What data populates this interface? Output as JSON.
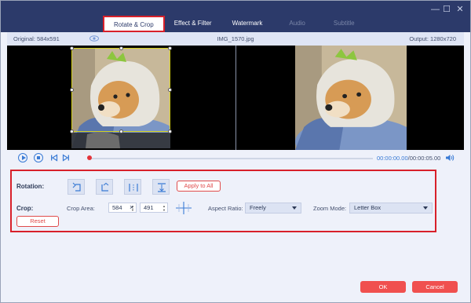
{
  "window": {
    "controls": {
      "minimize_glyph": "—",
      "maximize_glyph": "☐",
      "close_glyph": "✕"
    }
  },
  "tabs": [
    {
      "label": "Rotate & Crop",
      "state": "active"
    },
    {
      "label": "Effect & Filter",
      "state": "normal"
    },
    {
      "label": "Watermark",
      "state": "normal"
    },
    {
      "label": "Audio",
      "state": "disabled"
    },
    {
      "label": "Subtitle",
      "state": "disabled"
    }
  ],
  "info": {
    "original": "Original: 584x591",
    "filename": "IMG_1570.jpg",
    "output": "Output: 1280x720"
  },
  "playback": {
    "current_time": "00:00:00.00",
    "total_time": "/00:00:05.00",
    "progress": 0
  },
  "rotation": {
    "label": "Rotation:",
    "buttons": [
      "rotate-left-icon",
      "rotate-right-icon",
      "flip-horizontal-icon",
      "flip-vertical-icon"
    ],
    "apply_all": "Apply to All"
  },
  "crop": {
    "label": "Crop:",
    "area_label": "Crop Area:",
    "width": "584",
    "times": "×",
    "height": "491",
    "aspect_label": "Aspect Ratio:",
    "aspect_value": "Freely",
    "zoom_label": "Zoom Mode:",
    "zoom_value": "Letter Box",
    "reset": "Reset"
  },
  "footer": {
    "ok": "OK",
    "cancel": "Cancel"
  },
  "colors": {
    "accent": "#3a7bd5",
    "danger": "#d8202a",
    "header": "#2c3a6a",
    "button": "#f0504f"
  }
}
